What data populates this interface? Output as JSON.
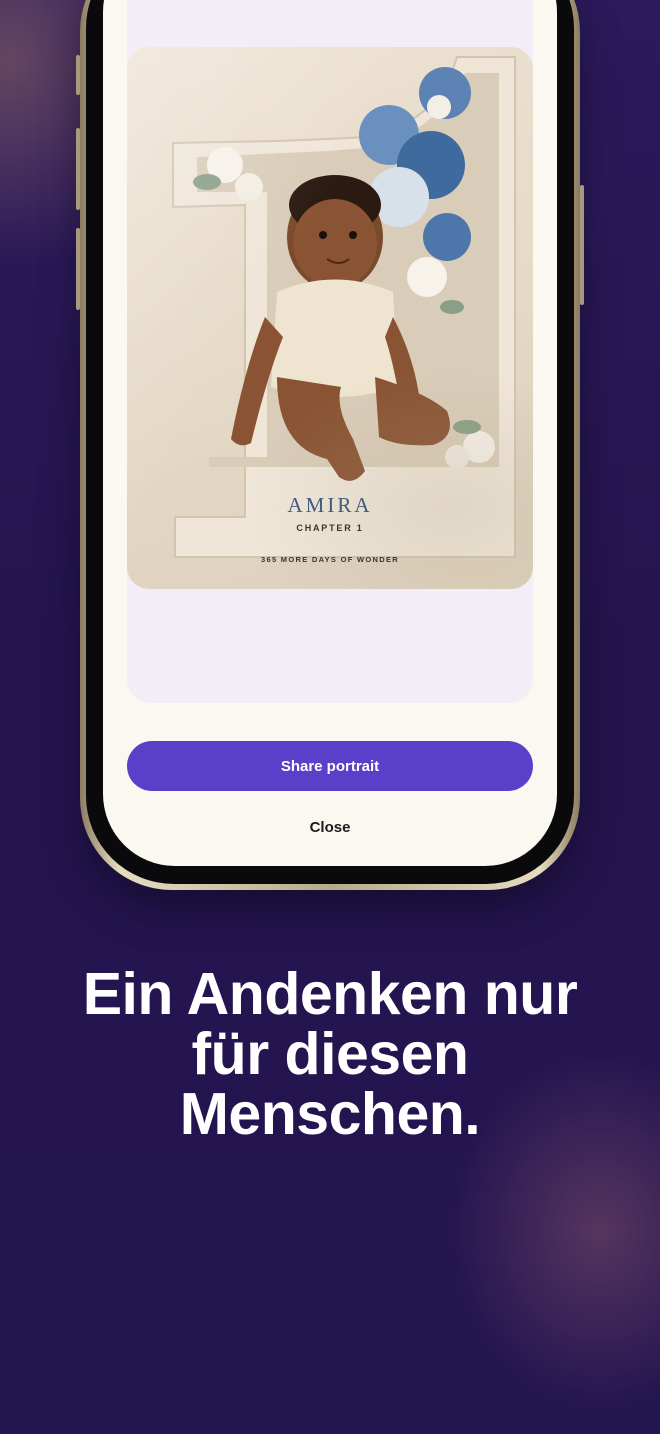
{
  "portrait": {
    "name": "AMIRA",
    "chapter": "CHAPTER 1",
    "tagline": "365 MORE DAYS OF WONDER"
  },
  "actions": {
    "share_label": "Share portrait",
    "close_label": "Close"
  },
  "headline": {
    "lines": [
      "Ein Andenken nur",
      "für diesen",
      "Menschen."
    ]
  },
  "colors": {
    "background": "#261654",
    "accent": "#5a3fc8",
    "screen": "#fbf7f1",
    "card": "#f2edf6"
  }
}
